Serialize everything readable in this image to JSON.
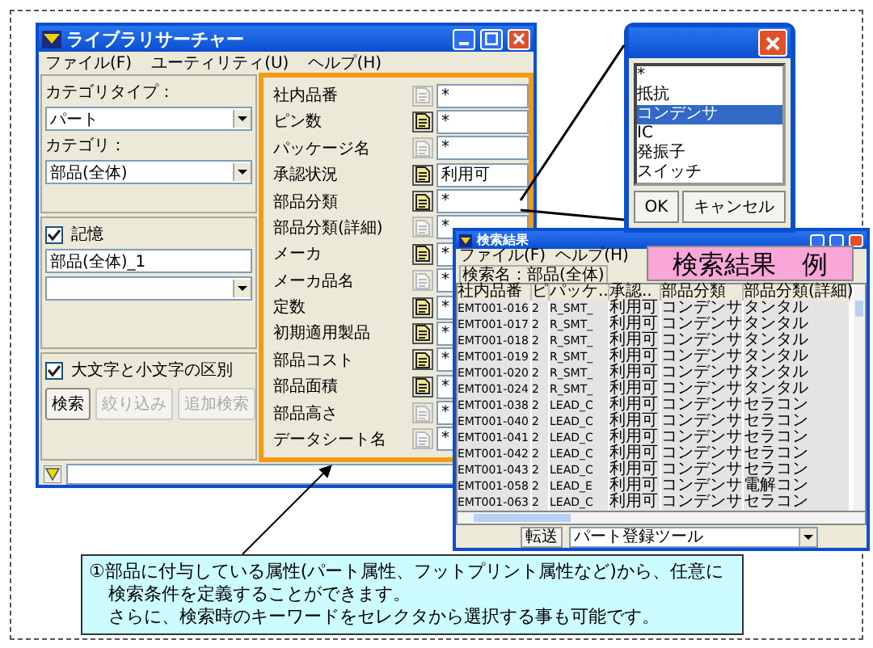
{
  "window": {
    "title": "ライブラリサーチャー",
    "menu": [
      "ファイル(F)",
      "ユーティリティ(U)",
      "ヘルプ(H)"
    ]
  },
  "category": {
    "type_label": "カテゴリタイプ：",
    "type_value": "パート",
    "label": "カテゴリ：",
    "value": "部品(全体)"
  },
  "memory": {
    "label": "記憶",
    "checked": true,
    "value": "部品(全体)_1"
  },
  "case_sensitive": {
    "label": "大文字と小文字の区別",
    "checked": true
  },
  "buttons": [
    {
      "label": "検索",
      "disabled": false
    },
    {
      "label": "絞り込み",
      "disabled": true
    },
    {
      "label": "追加検索",
      "disabled": true
    }
  ],
  "attributes": [
    {
      "label": "社内品番",
      "selector": false,
      "value": "*"
    },
    {
      "label": "ピン数",
      "selector": true,
      "value": "*"
    },
    {
      "label": "パッケージ名",
      "selector": false,
      "value": "*"
    },
    {
      "label": "承認状況",
      "selector": true,
      "value": "利用可"
    },
    {
      "label": "部品分類",
      "selector": true,
      "value": "*"
    },
    {
      "label": "部品分類(詳細)",
      "selector": false,
      "value": "*"
    },
    {
      "label": "メーカ",
      "selector": true,
      "value": "*"
    },
    {
      "label": "メーカ品名",
      "selector": false,
      "value": "*"
    },
    {
      "label": "定数",
      "selector": true,
      "value": "*"
    },
    {
      "label": "初期適用製品",
      "selector": true,
      "value": "*"
    },
    {
      "label": "部品コスト",
      "selector": true,
      "value": "*"
    },
    {
      "label": "部品面積",
      "selector": true,
      "value": "*"
    },
    {
      "label": "部品高さ",
      "selector": false,
      "value": "*"
    },
    {
      "label": "データシート名",
      "selector": false,
      "value": "*"
    }
  ],
  "selector_dialog": {
    "items": [
      {
        "label": "*",
        "selected": false
      },
      {
        "label": "抵抗",
        "selected": false
      },
      {
        "label": "コンデンサ",
        "selected": true
      },
      {
        "label": "IC",
        "selected": false
      },
      {
        "label": "発振子",
        "selected": false
      },
      {
        "label": "スイッチ",
        "selected": false
      }
    ],
    "buttons": [
      "OK",
      "キャンセル"
    ]
  },
  "results_window": {
    "title": "検索結果",
    "menu": [
      "ファイル(F)",
      "ヘルプ(H)"
    ],
    "tab": "検索名：部品(全体)",
    "columns": [
      "社内品番",
      "ピ",
      "パッケ..",
      "承認..",
      "部品分類",
      "部品分類(詳細)"
    ],
    "rows": [
      [
        "EMT001-016",
        "2",
        "R_SMT_",
        "利用可",
        "コンデンサ",
        "タンタル"
      ],
      [
        "EMT001-017",
        "2",
        "R_SMT_",
        "利用可",
        "コンデンサ",
        "タンタル"
      ],
      [
        "EMT001-018",
        "2",
        "R_SMT_",
        "利用可",
        "コンデンサ",
        "タンタル"
      ],
      [
        "EMT001-019",
        "2",
        "R_SMT_",
        "利用可",
        "コンデンサ",
        "タンタル"
      ],
      [
        "EMT001-020",
        "2",
        "R_SMT_",
        "利用可",
        "コンデンサ",
        "タンタル"
      ],
      [
        "EMT001-024",
        "2",
        "R_SMT_",
        "利用可",
        "コンデンサ",
        "タンタル"
      ],
      [
        "EMT001-038",
        "2",
        "LEAD_C",
        "利用可",
        "コンデンサ",
        "セラコン"
      ],
      [
        "EMT001-040",
        "2",
        "LEAD_C",
        "利用可",
        "コンデンサ",
        "セラコン"
      ],
      [
        "EMT001-041",
        "2",
        "LEAD_C",
        "利用可",
        "コンデンサ",
        "セラコン"
      ],
      [
        "EMT001-042",
        "2",
        "LEAD_C",
        "利用可",
        "コンデンサ",
        "セラコン"
      ],
      [
        "EMT001-043",
        "2",
        "LEAD_C",
        "利用可",
        "コンデンサ",
        "セラコン"
      ],
      [
        "EMT001-058",
        "2",
        "LEAD_E",
        "利用可",
        "コンデンサ",
        "電解コン"
      ],
      [
        "EMT001-063",
        "2",
        "LEAD_C",
        "利用可",
        "コンデンサ",
        "セラコン"
      ]
    ],
    "transfer_label": "転送",
    "transfer_value": "パート登録ツール"
  },
  "overlay_label": "検索結果　例",
  "callout": {
    "lines": [
      "①部品に付与している属性(パート属性、フットプリント属性など)から、任意に",
      "検索条件を定義することができます。",
      "さらに、検索時のキーワードをセレクタから選択する事も可能です。"
    ]
  }
}
